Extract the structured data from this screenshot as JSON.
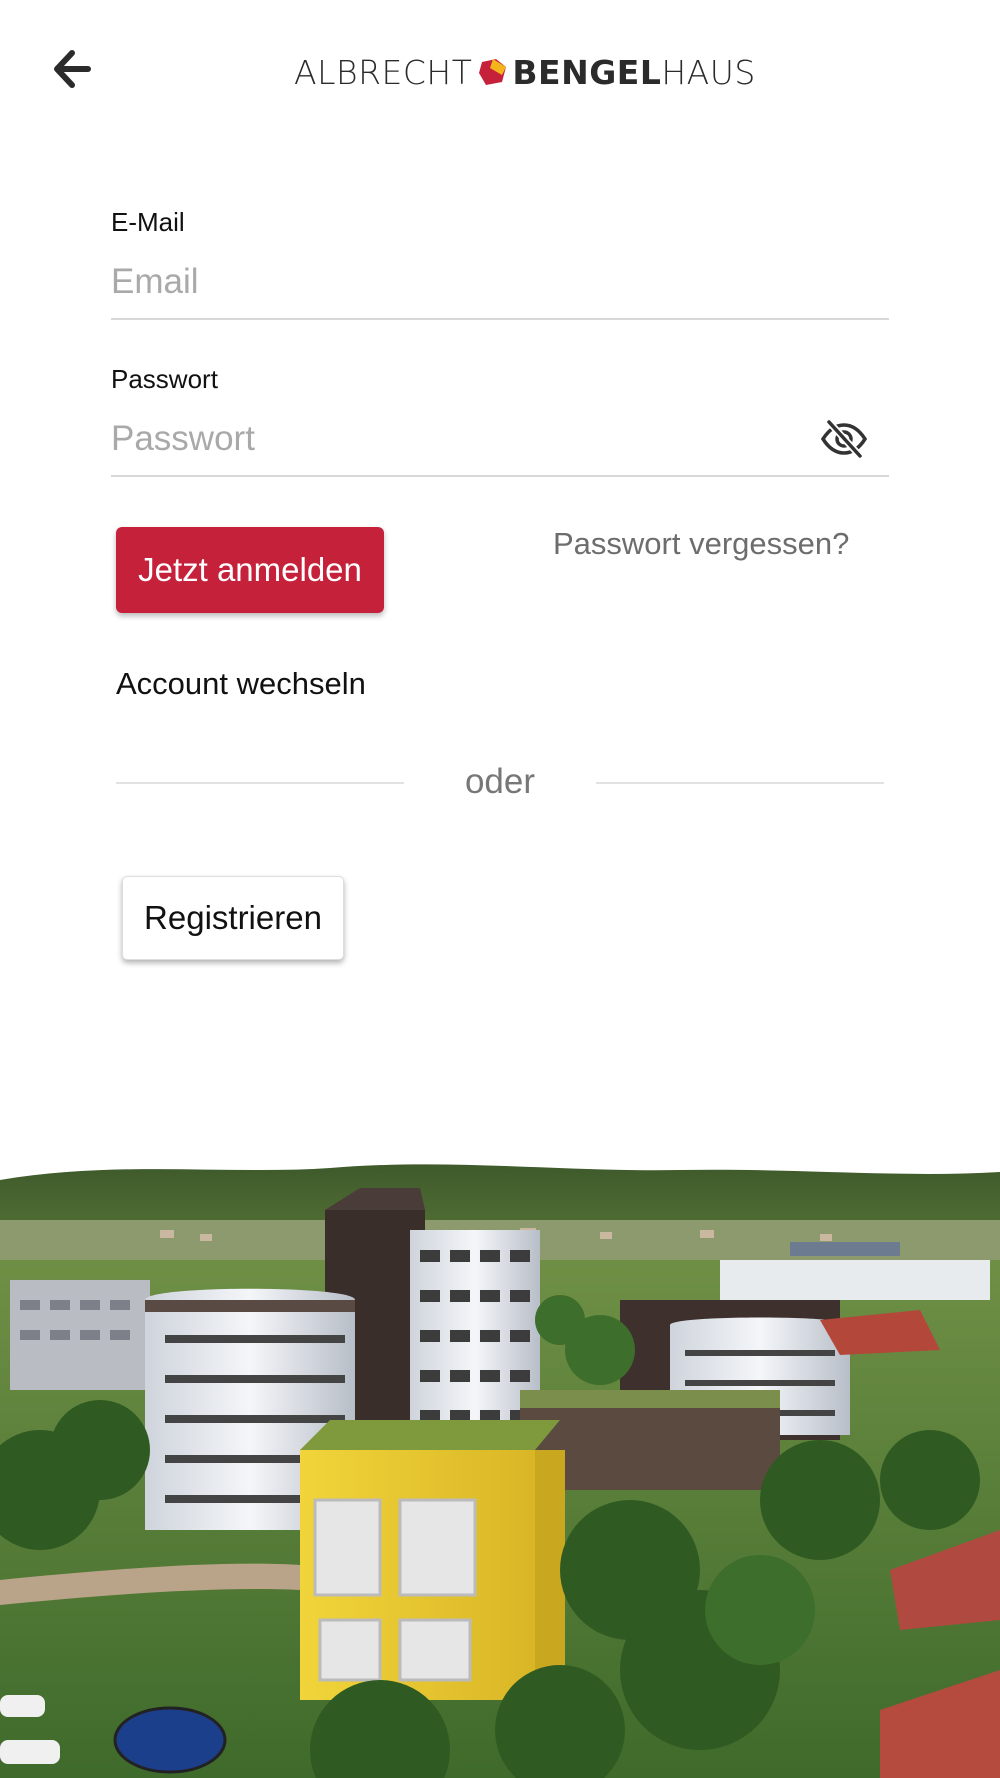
{
  "header": {
    "back_icon": "arrow-left-icon",
    "logo": {
      "part1": "ALBRECHT",
      "part2": "BENGEL",
      "part3": "HAUS",
      "mark_colors": [
        "#c5213a",
        "#f3b51b"
      ]
    }
  },
  "form": {
    "email": {
      "label": "E-Mail",
      "placeholder": "Email",
      "value": ""
    },
    "password": {
      "label": "Passwort",
      "placeholder": "Passwort",
      "value": "",
      "toggle_icon": "eye-slash-icon"
    },
    "login_button": "Jetzt anmelden",
    "forgot_password": "Passwort vergessen?",
    "switch_account": "Account wechseln",
    "divider": "oder",
    "register_button": "Registrieren"
  },
  "colors": {
    "primary": "#c5213a",
    "muted_text": "#6d6d6d",
    "divider": "#e2e2e2"
  },
  "background_image": "aerial-photo-of-building-complex"
}
